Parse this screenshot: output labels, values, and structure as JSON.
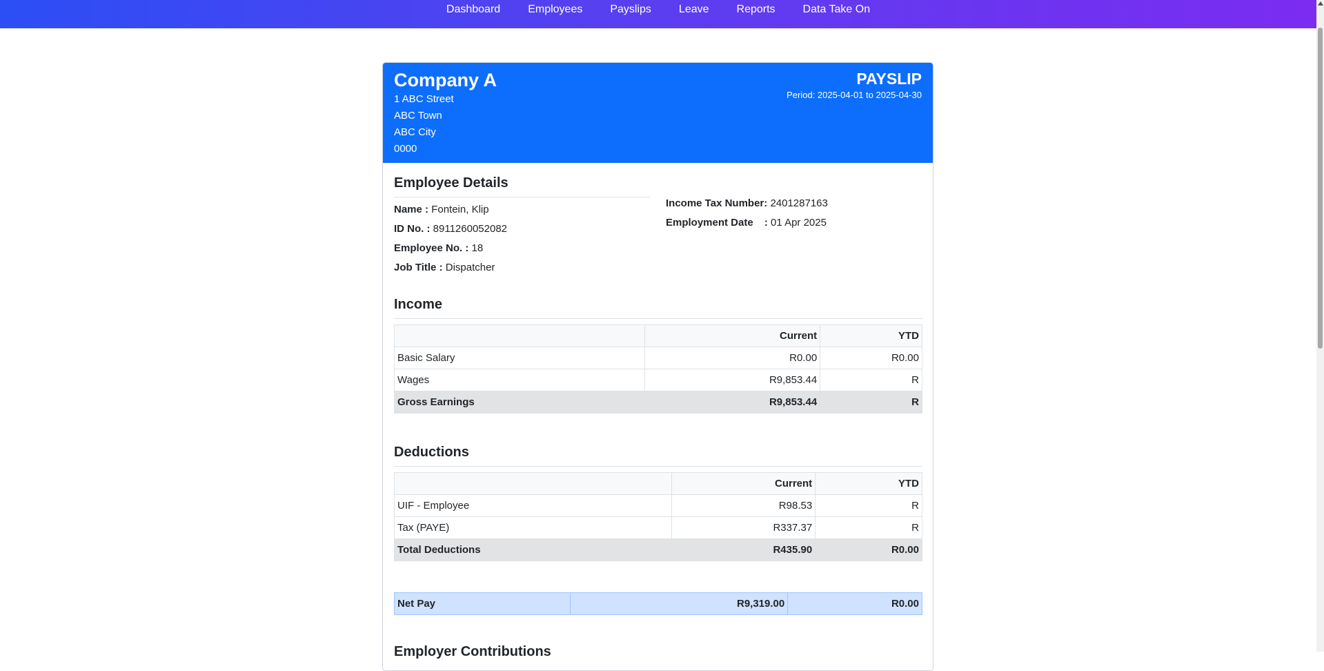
{
  "nav": {
    "items": [
      "Dashboard",
      "Employees",
      "Payslips",
      "Leave",
      "Reports",
      "Data Take On"
    ]
  },
  "company": {
    "name": "Company A",
    "address": [
      "1 ABC Street",
      "ABC Town",
      "ABC City",
      "0000"
    ]
  },
  "payslip": {
    "title": "PAYSLIP",
    "period": "Period: 2025-04-01 to 2025-04-30"
  },
  "employee": {
    "heading": "Employee Details",
    "name_label": "Name  :",
    "name": "Fontein, Klip",
    "id_label": "ID No. :",
    "id": "8911260052082",
    "empno_label": "Employee No. :",
    "empno": "18",
    "job_label": "Job Title :",
    "job": "Dispatcher",
    "tax_label": "Income Tax Number:",
    "tax": "2401287163",
    "date_label": "Employment Date",
    "date_sep": ":",
    "date": "01 Apr 2025"
  },
  "income": {
    "heading": "Income",
    "col_current": "Current",
    "col_ytd": "YTD",
    "rows": [
      {
        "label": "Basic Salary",
        "current": "R0.00",
        "ytd": "R0.00"
      },
      {
        "label": "Wages",
        "current": "R9,853.44",
        "ytd": "R"
      }
    ],
    "total": {
      "label": "Gross Earnings",
      "current": "R9,853.44",
      "ytd": "R"
    }
  },
  "deductions": {
    "heading": "Deductions",
    "col_current": "Current",
    "col_ytd": "YTD",
    "rows": [
      {
        "label": "UIF - Employee",
        "current": "R98.53",
        "ytd": "R"
      },
      {
        "label": "Tax (PAYE)",
        "current": "R337.37",
        "ytd": "R"
      }
    ],
    "total": {
      "label": "Total Deductions",
      "current": "R435.90",
      "ytd": "R0.00"
    }
  },
  "net": {
    "label": "Net Pay",
    "current": "R9,319.00",
    "ytd": "R0.00"
  },
  "employer": {
    "heading": "Employer Contributions"
  }
}
